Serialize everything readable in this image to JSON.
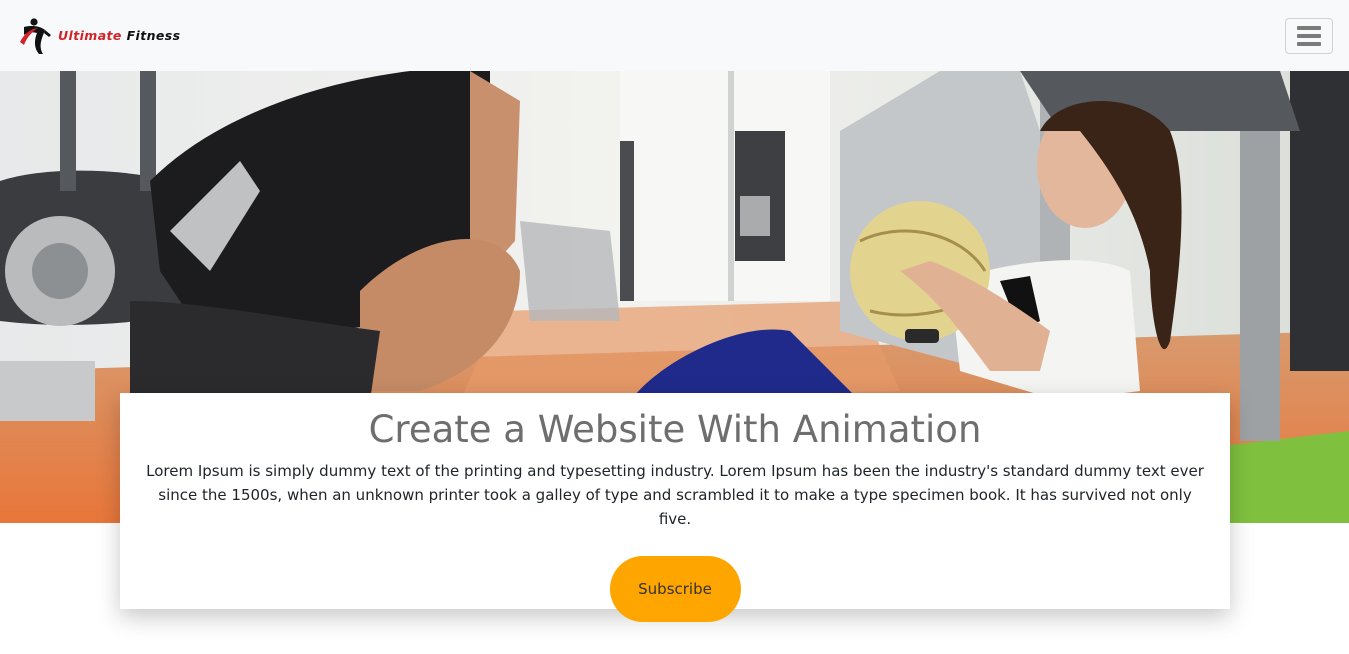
{
  "navbar": {
    "brand_word1": "Ultimate",
    "brand_word2": "Fitness",
    "toggler_icon": "hamburger-menu-icon"
  },
  "hero": {
    "image": "gym-trainer-and-woman-with-medicine-ball"
  },
  "card": {
    "title": "Create a Website With Animation",
    "body": "Lorem Ipsum is simply dummy text of the printing and typesetting industry. Lorem Ipsum has been the industry's standard dummy text ever since the 1500s, when an unknown printer took a galley of type and scrambled it to make a type specimen book. It has survived not only five.",
    "button_label": "Subscribe"
  },
  "colors": {
    "navbar_bg": "#f8f9fa",
    "brand_red": "#d2232a",
    "button_orange": "#fea500",
    "title_gray": "#6e6e6e"
  }
}
